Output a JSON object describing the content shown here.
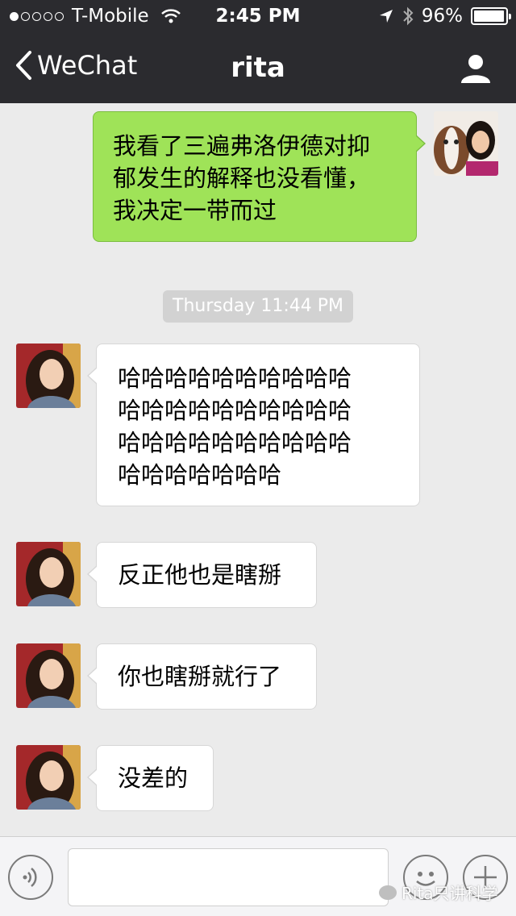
{
  "status_bar": {
    "carrier": "T-Mobile",
    "time": "2:45 PM",
    "battery": "96%",
    "signal_icons": [
      "signal-dots-icon",
      "wifi-icon",
      "location-arrow-icon",
      "bluetooth-icon",
      "battery-icon"
    ]
  },
  "nav": {
    "back_label": "WeChat",
    "title": "rita",
    "profile_icon": "person-icon"
  },
  "messages": [
    {
      "side": "right",
      "text_lines": [
        "我看了三遍弗洛伊德对抑",
        "郁发生的解释也没看懂，",
        "我决定一带而过"
      ]
    },
    {
      "side": "left",
      "text_lines": [
        "哈哈哈哈哈哈哈哈哈哈",
        "哈哈哈哈哈哈哈哈哈哈",
        "哈哈哈哈哈哈哈哈哈哈",
        "哈哈哈哈哈哈哈"
      ]
    },
    {
      "side": "left",
      "text_lines": [
        "反正他也是瞎掰"
      ]
    },
    {
      "side": "left",
      "text_lines": [
        "你也瞎掰就行了"
      ]
    },
    {
      "side": "left",
      "text_lines": [
        "没差的"
      ]
    }
  ],
  "timestamp": "Thursday 11:44 PM",
  "input_bar": {
    "voice_icon": "voice-icon",
    "emoji_icon": "emoji-icon",
    "plus_icon": "plus-icon"
  },
  "watermark": "Rita只讲科学",
  "colors": {
    "header_bg": "#2b2b2f",
    "chat_bg": "#ebebeb",
    "sent_bubble": "#9fe358",
    "received_bubble": "#ffffff"
  }
}
